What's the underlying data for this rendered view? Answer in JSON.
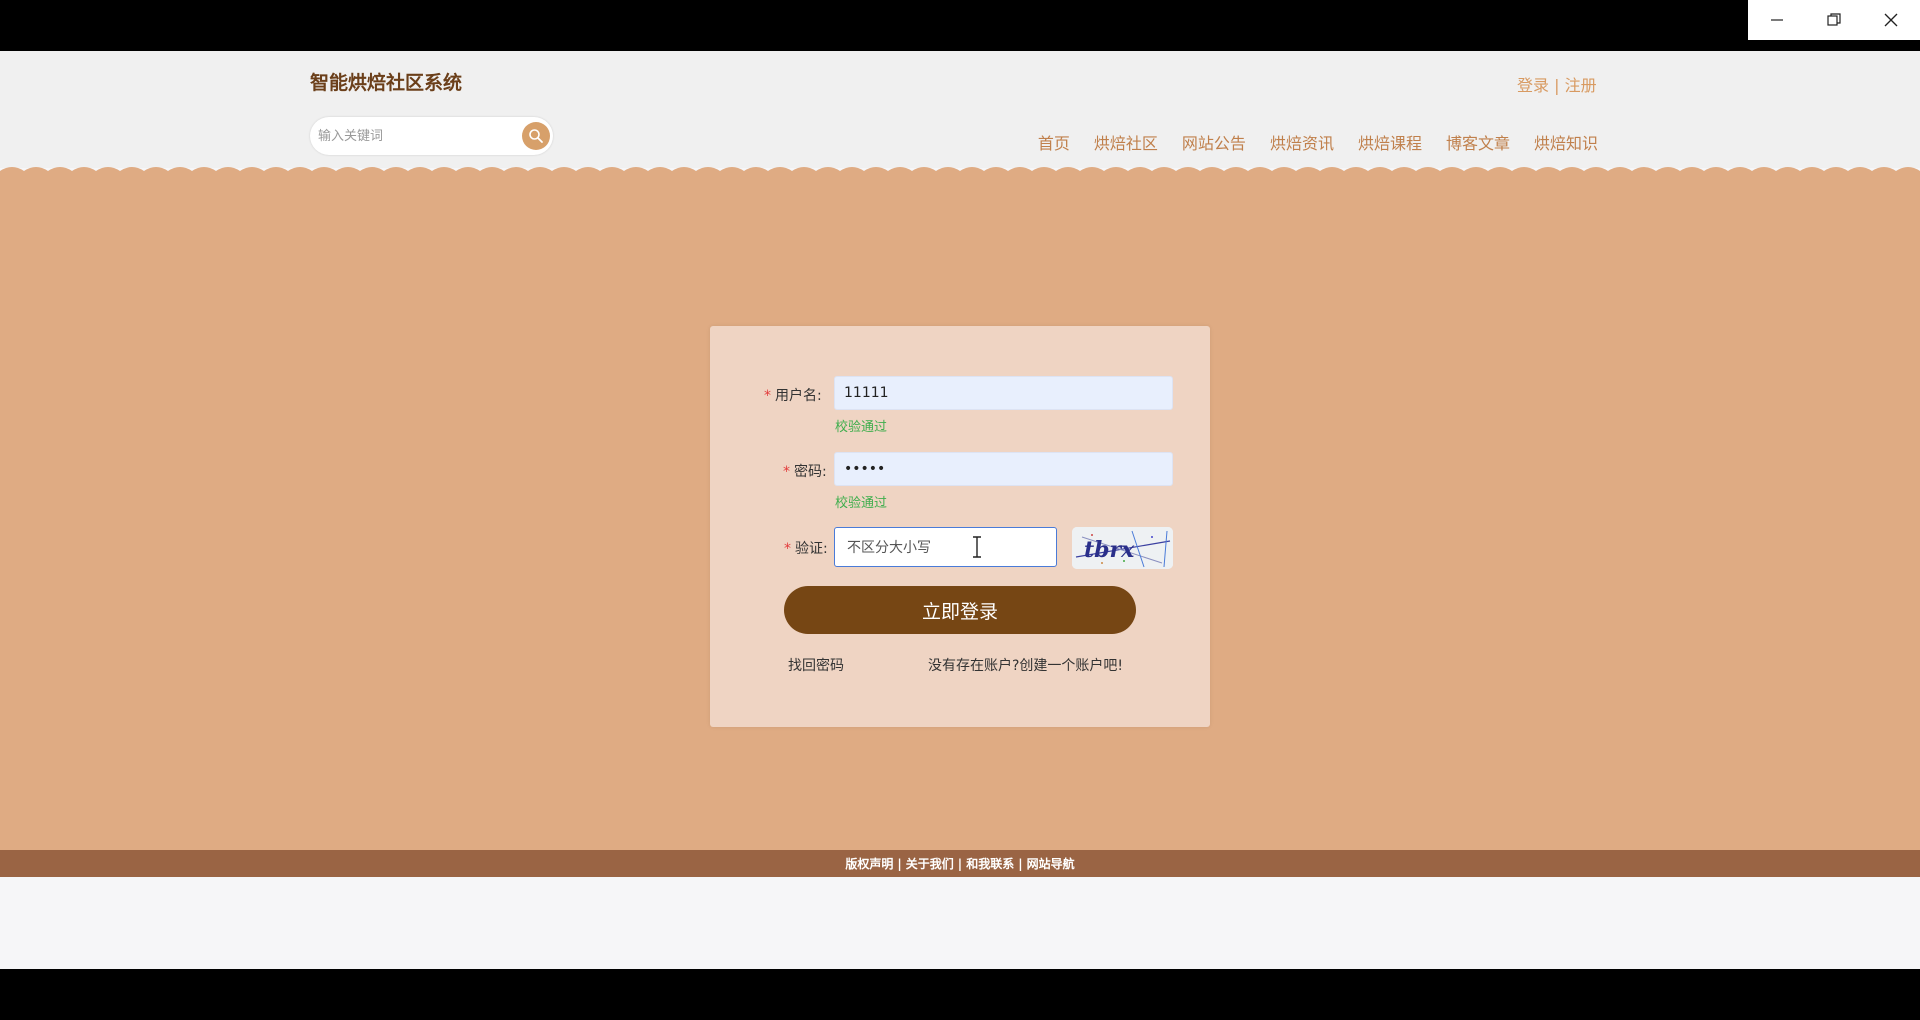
{
  "window": {
    "minimize_icon": "minimize-icon",
    "restore_icon": "restore-icon",
    "close_icon": "close-icon"
  },
  "header": {
    "brand": "智能烘焙社区系统",
    "auth": {
      "login": "登录",
      "separator": "|",
      "register": "注册"
    },
    "search": {
      "placeholder": "输入关键词",
      "icon": "search-icon"
    },
    "nav": [
      "首页",
      "烘焙社区",
      "网站公告",
      "烘焙资讯",
      "烘焙课程",
      "博客文章",
      "烘焙知识"
    ]
  },
  "login_form": {
    "required_mark": "*",
    "username": {
      "label": "用户名:",
      "value": "11111",
      "status": "校验通过"
    },
    "password": {
      "label": "密码:",
      "value": "•••••",
      "status": "校验通过"
    },
    "captcha": {
      "label": "验证:",
      "placeholder": "不区分大小写",
      "image_text": "tbrx"
    },
    "submit": "立即登录",
    "forgot": "找回密码",
    "register_link": "没有存在账户?创建一个账户吧!"
  },
  "footer": {
    "links": [
      "版权声明",
      "关于我们",
      "和我联系",
      "网站导航"
    ],
    "separator": "|"
  },
  "colors": {
    "accent": "#764614",
    "background": "#dfab83",
    "card": "#efd4c3",
    "nav": "#c0804c",
    "success": "#3fae4d",
    "footer": "#9a6444"
  }
}
